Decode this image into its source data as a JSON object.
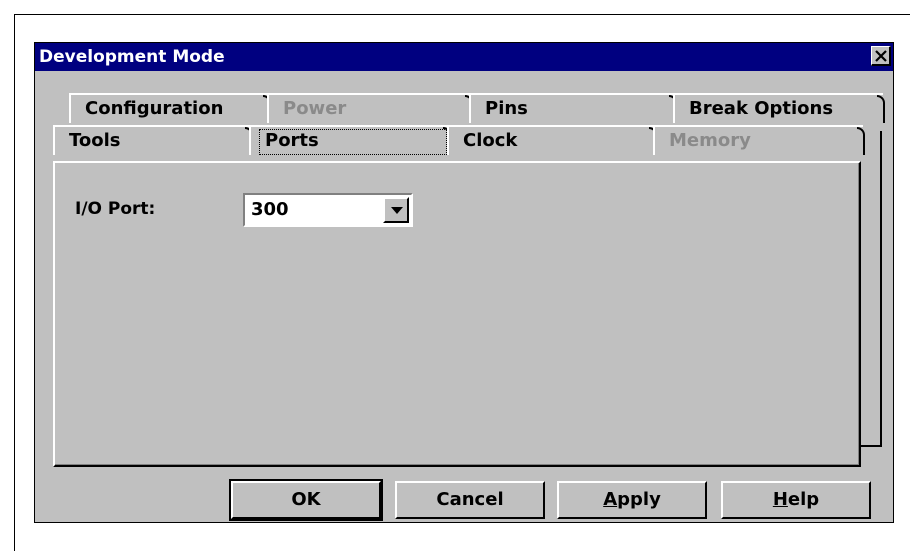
{
  "window": {
    "title": "Development Mode",
    "close_icon": "close-icon"
  },
  "tabs_back": [
    {
      "label": "Configuration",
      "disabled": false
    },
    {
      "label": "Power",
      "disabled": true
    },
    {
      "label": "Pins",
      "disabled": false
    },
    {
      "label": "Break Options",
      "disabled": false
    }
  ],
  "tabs_front": [
    {
      "label": "Tools",
      "disabled": false
    },
    {
      "label": "Ports",
      "disabled": false,
      "selected": true
    },
    {
      "label": "Clock",
      "disabled": false
    },
    {
      "label": "Memory",
      "disabled": true
    }
  ],
  "ports": {
    "io_port_label": "I/O Port:",
    "io_port_value": "300",
    "dropdown_icon": "chevron-down-icon"
  },
  "buttons": {
    "ok": "OK",
    "cancel": "Cancel",
    "apply": "Apply",
    "help": "Help"
  }
}
